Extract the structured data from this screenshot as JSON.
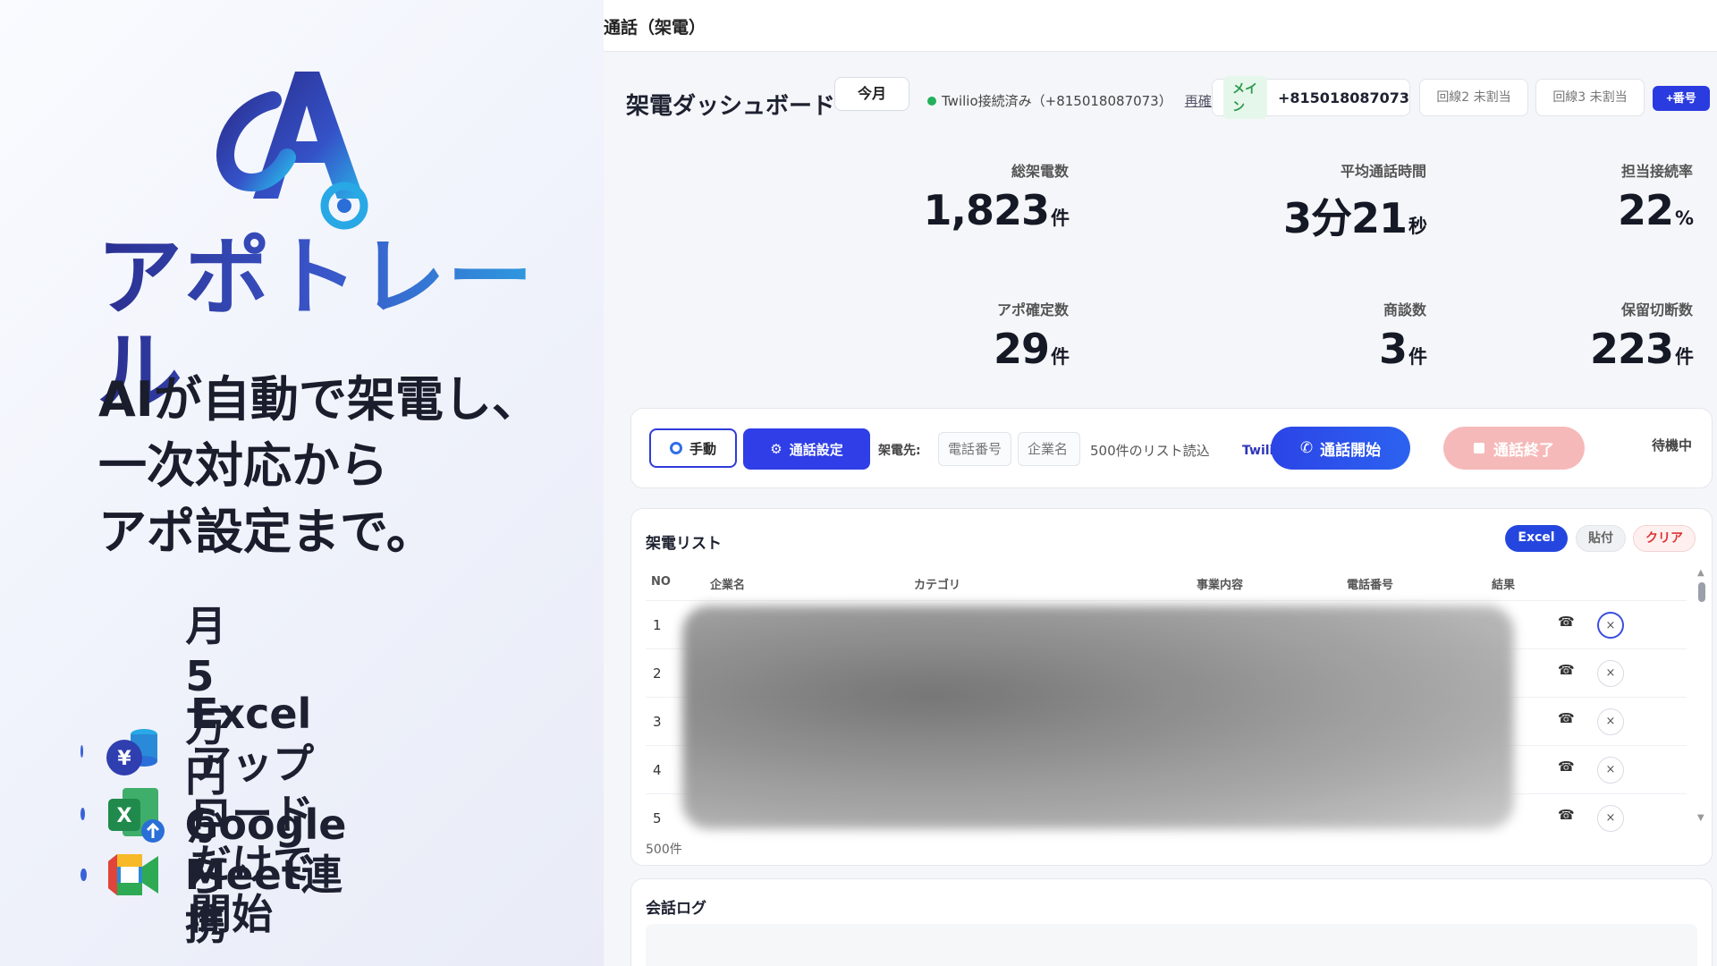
{
  "promo": {
    "brand": "アポトレール",
    "headline": [
      "AIが自動で架電し、",
      "一次対応から",
      "アポ設定まで。"
    ],
    "features": [
      {
        "text": [
          "月5万円から"
        ],
        "icon": "yen-coins-icon"
      },
      {
        "text": [
          "Excelアップロード",
          "だけで開始"
        ],
        "icon": "excel-upload-icon"
      },
      {
        "text": [
          "Google Meet連携"
        ],
        "icon": "google-meet-icon"
      }
    ]
  },
  "app": {
    "breadcrumb": "通話（架電）",
    "dashboard_title": "架電ダッシュボード",
    "period": "今月",
    "twilio_status": "Twilio接続済み（+815018087073）",
    "recheck": "再確認",
    "lines": {
      "main_tag": "メイン",
      "main_number": "+815018087073",
      "line2": "回線2  未割当",
      "line3": "回線3  未割当",
      "add_button": "+番号"
    },
    "kpis": [
      {
        "label": "総架電数",
        "value": "1,823",
        "unit": "件"
      },
      {
        "label": "平均通話時間",
        "value": "3分21",
        "unit": "秒"
      },
      {
        "label": "担当接続率",
        "value": "22",
        "unit": "%"
      },
      {
        "label": "アポ確定数",
        "value": "29",
        "unit": "件"
      },
      {
        "label": "商談数",
        "value": "3",
        "unit": "件"
      },
      {
        "label": "保留切断数",
        "value": "223",
        "unit": "件"
      }
    ],
    "controls": {
      "manual": "手動",
      "call_settings": "通話設定",
      "caller_label": "架電先:",
      "phone_placeholder": "電話番号",
      "company_placeholder": "企業名",
      "list_note": "500件のリスト読込",
      "twilio_connecting": "Twilio接続中",
      "start_call": "通話開始",
      "end_call": "通話終了",
      "standby": "待機中"
    },
    "call_list": {
      "title": "架電リスト",
      "excel": "Excel",
      "paste": "貼付",
      "clear": "クリア",
      "columns": [
        "NO",
        "企業名",
        "カテゴリ",
        "事業内容",
        "電話番号",
        "結果"
      ],
      "rows": [
        "1",
        "2",
        "3",
        "4",
        "5"
      ],
      "footer": "500件",
      "row_call_icon": "☎",
      "row_remove_icon": "×"
    },
    "log": {
      "title": "会話ログ"
    }
  },
  "colors": {
    "accent": "#2f3ee6",
    "connected": "#22b05a",
    "end_call": "#f6b9b9",
    "brand_gradient": [
      "#2a2f8f",
      "#2ab0e6"
    ]
  }
}
